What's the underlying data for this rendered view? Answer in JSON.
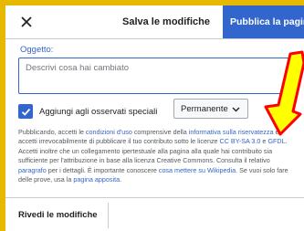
{
  "header": {
    "title": "Salva le modifiche",
    "publish_label": "Pubblica la pagina"
  },
  "subject": {
    "label": "Oggetto:",
    "placeholder": "Descrivi cosa hai cambiato",
    "value": ""
  },
  "watchlist": {
    "checked": true,
    "label": "Aggiungi agli osservati speciali",
    "duration": "Permanente"
  },
  "legal": {
    "t1": "Pubblicando, accetti le ",
    "l1": "condizioni d'uso",
    "t2": " comprensive della ",
    "l2": "informativa sulla riservatezza",
    "t3": " e accetti irrevocabilmente di pubblicare il tuo contributo sotto le licenze ",
    "l3": "CC BY-SA 3.0",
    "t4": " e ",
    "l4": "GFDL",
    "t5": ". Accetti inoltre che un collegamento ipertestuale alla pagina alla quale hai contribuito sia sufficiente per l'attribuzione in base alla licenza Creative Commons. Consulta il relativo ",
    "l5": "paragrafo",
    "t6": " per i dettagli. È importante conoscere ",
    "l6": "cosa mettere su Wikipedia",
    "t7": ". Se vuoi solo fare delle prove, usa la ",
    "l7": "pagina apposita",
    "t8": "."
  },
  "tabs": {
    "review_label": "Rivedi le modifiche"
  },
  "colors": {
    "accent": "#3366cc",
    "frame": "#e6b800",
    "arrow_fill": "#ffff00",
    "arrow_stroke": "#ff0000"
  }
}
